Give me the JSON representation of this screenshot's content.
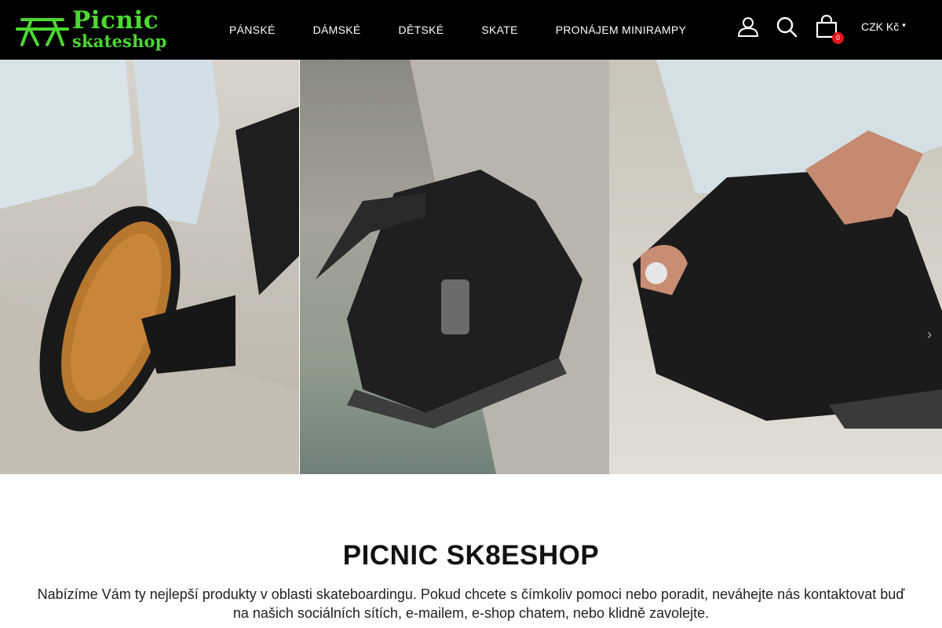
{
  "logo": {
    "line1": "Picnic",
    "line2": "skateshop"
  },
  "nav": {
    "items": [
      {
        "label": "PÁNSKÉ"
      },
      {
        "label": "DÁMSKÉ"
      },
      {
        "label": "DĚTSKÉ"
      },
      {
        "label": "SKATE"
      },
      {
        "label": "PRONÁJEM MINIRAMPY"
      }
    ]
  },
  "header_actions": {
    "user_icon": "user-icon",
    "search_icon": "search-icon",
    "cart_icon": "cart-icon",
    "cart_count": "0",
    "currency": "CZK Kč",
    "currency_caret": "▾"
  },
  "hero": {
    "next_arrow": "›"
  },
  "intro": {
    "title": "PICNIC SK8ESHOP",
    "text": "Nabízíme Vám ty nejlepší produkty v oblasti skateboardingu. Pokud chcete s čímkoliv pomoci nebo poradit, neváhejte nás kontaktovat buď na našich sociálních sítích, e-mailem, e-shop chatem, nebo klidně zavolejte."
  },
  "colors": {
    "header_bg": "#000000",
    "brand_green": "#4bd832",
    "badge_red": "#e4141b"
  }
}
